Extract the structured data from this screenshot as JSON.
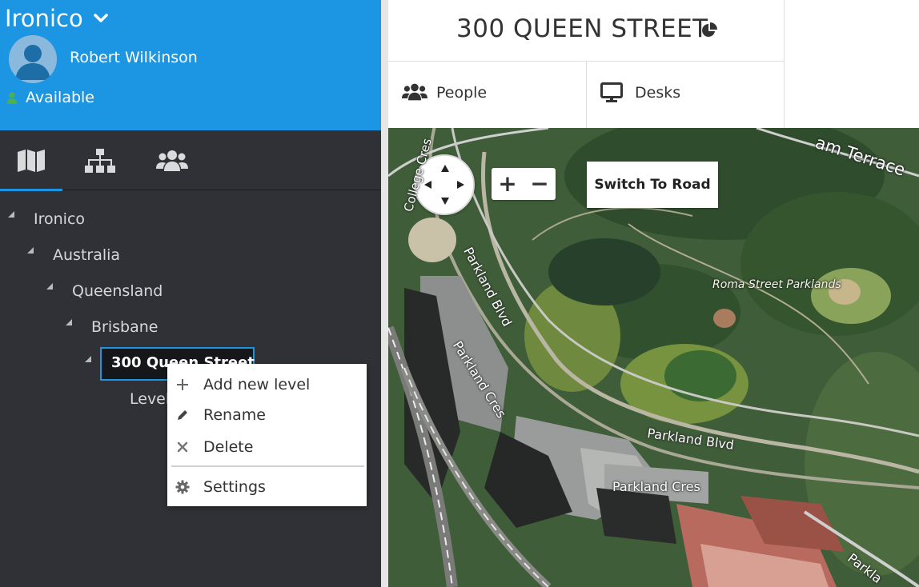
{
  "sidebar": {
    "org_name": "Ironico",
    "user_name": "Robert Wilkinson",
    "status": "Available",
    "tabs": [
      {
        "icon": "map-icon",
        "active": true
      },
      {
        "icon": "hierarchy-icon",
        "active": false
      },
      {
        "icon": "users-icon",
        "active": false
      }
    ],
    "tree": {
      "root": "Ironico",
      "country": "Australia",
      "state": "Queensland",
      "city": "Brisbane",
      "building": "300 Queen Street",
      "level_prefix": "Level"
    }
  },
  "context_menu": {
    "items": [
      {
        "icon": "plus-icon",
        "label": "Add new level"
      },
      {
        "icon": "pencil-icon",
        "label": "Rename"
      },
      {
        "icon": "close-icon",
        "label": "Delete"
      },
      {
        "icon": "gear-icon",
        "label": "Settings"
      }
    ]
  },
  "header": {
    "building_title": "300 QUEEN STREET",
    "nav": [
      {
        "icon": "people-icon",
        "label": "People"
      },
      {
        "icon": "monitor-icon",
        "label": "Desks"
      }
    ]
  },
  "map": {
    "switch_label": "Switch To Road",
    "zoom_in": "+",
    "zoom_out": "−",
    "labels": {
      "terrace": "am Terrace",
      "college": "College Cres",
      "park": "Roma Street Parklands",
      "parkland_blvd_1": "Parkland Blvd",
      "parkland_cres_1": "Parkland Cres",
      "parkland_blvd_2": "Parkland Blvd",
      "parkland_cres_2": "Parkland Cres",
      "parkland_corner": "Parkla"
    }
  },
  "colors": {
    "accent": "#1c96e2",
    "sidebar_bg": "#2f3136",
    "status_green": "#4caf50"
  }
}
